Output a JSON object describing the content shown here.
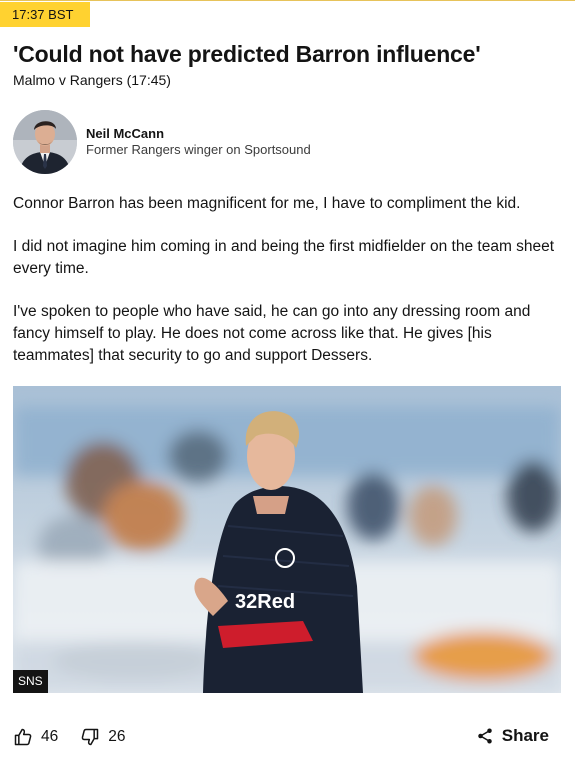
{
  "post": {
    "timestamp": "17:37 BST",
    "headline": "'Could not have predicted Barron influence'",
    "match": "Malmo v Rangers (17:45)"
  },
  "author": {
    "name": "Neil McCann",
    "role": "Former Rangers winger on Sportsound"
  },
  "body": {
    "paragraphs": [
      "Connor Barron has been magnificent for me, I have to compliment the kid.",
      "I did not imagine him coming in and being the first midfielder on the team sheet every time.",
      "I've spoken to people who have said, he can go into any dressing room and fancy himself to play. He does not come across like that. He gives [his teammates] that security to go and support Dessers."
    ]
  },
  "image": {
    "credit": "SNS",
    "shirt_sponsor": "32Red"
  },
  "actions": {
    "likes": "46",
    "dislikes": "26",
    "share_label": "Share",
    "like_icon": "thumbs-up-icon",
    "dislike_icon": "thumbs-down-icon",
    "share_icon": "share-icon"
  },
  "colors": {
    "timestamp_bg": "#ffd230",
    "text": "#141414",
    "shirt_navy": "#1a2233",
    "shirt_red": "#d81e2c"
  }
}
